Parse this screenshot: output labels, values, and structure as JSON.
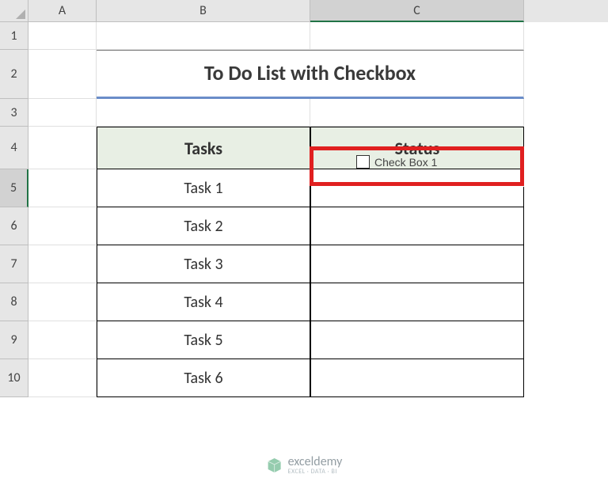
{
  "columns": [
    "A",
    "B",
    "C"
  ],
  "rows": [
    "1",
    "2",
    "3",
    "4",
    "5",
    "6",
    "7",
    "8",
    "9",
    "10"
  ],
  "selected_col": "C",
  "selected_row": "5",
  "title": "To Do List with Checkbox",
  "headers": {
    "tasks": "Tasks",
    "status": "Status"
  },
  "tasks": [
    "Task 1",
    "Task 2",
    "Task 3",
    "Task 4",
    "Task 5",
    "Task 6"
  ],
  "checkbox_label": "Check Box 1",
  "watermark": {
    "name": "exceldemy",
    "sub": "EXCEL · DATA · BI"
  }
}
